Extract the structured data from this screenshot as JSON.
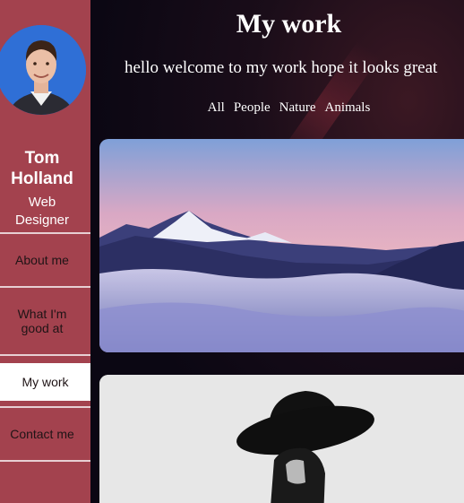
{
  "sidebar": {
    "profile_name": "Tom Holland",
    "profile_role": "Web Designer",
    "nav": [
      {
        "label": "About me"
      },
      {
        "label": "What I'm good at"
      },
      {
        "label": "My work"
      },
      {
        "label": "Contact me"
      }
    ],
    "active_nav": "My work"
  },
  "main": {
    "title": "My work",
    "subtitle": "hello welcome to my work hope it looks great",
    "filters": [
      {
        "label": "All"
      },
      {
        "label": "People"
      },
      {
        "label": "Nature"
      },
      {
        "label": "Animals"
      }
    ]
  },
  "colors": {
    "sidebar_bg": "#a3424e",
    "active_nav_bg": "#ffffff",
    "main_bg": "#0b0713",
    "title_text": "#ffffff"
  }
}
